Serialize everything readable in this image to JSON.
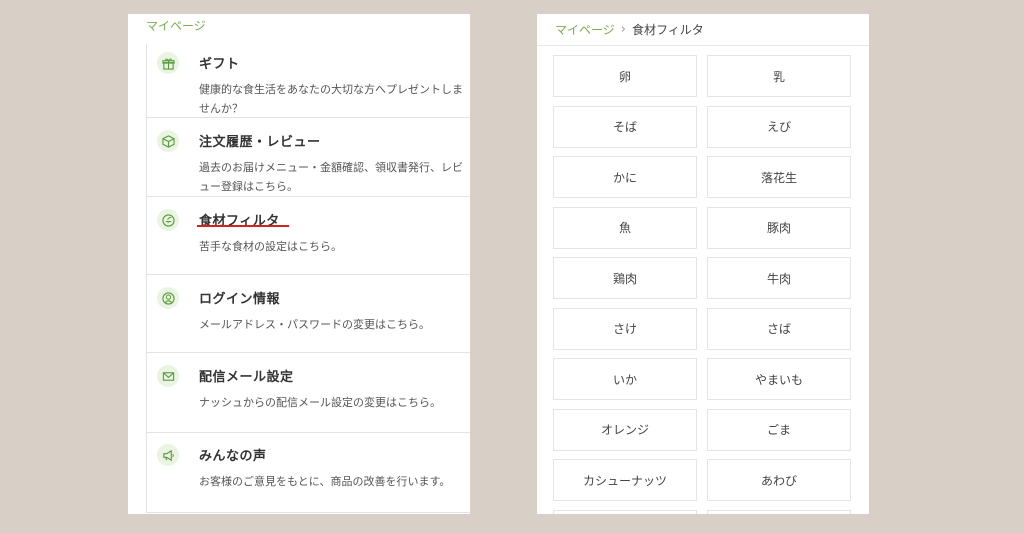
{
  "left": {
    "breadcrumb": "マイページ",
    "menu": [
      {
        "title": "ギフト",
        "desc": "健康的な食生活をあなたの大切な方へプレゼントしませんか？",
        "icon": "gift-icon"
      },
      {
        "title": "注文履歴・レビュー",
        "desc": "過去のお届けメニュー・金額確認、領収書発行、レビュー登録はこちら。",
        "icon": "box-icon"
      },
      {
        "title": "食材フィルタ",
        "desc": "苦手な食材の設定はこちら。",
        "icon": "food-bowl-icon"
      },
      {
        "title": "ログイン情報",
        "desc": "メールアドレス・パスワードの変更はこちら。",
        "icon": "user-icon"
      },
      {
        "title": "配信メール設定",
        "desc": "ナッシュからの配信メール設定の変更はこちら。",
        "icon": "mail-icon"
      },
      {
        "title": "みんなの声",
        "desc": "お客様のご意見をもとに、商品の改善を行います。",
        "icon": "megaphone-icon"
      }
    ]
  },
  "right": {
    "breadcrumb_link": "マイページ",
    "breadcrumb_sep": "›",
    "breadcrumb_current": "食材フィルタ",
    "items": [
      "卵",
      "乳",
      "そば",
      "えび",
      "かに",
      "落花生",
      "魚",
      "豚肉",
      "鶏肉",
      "牛肉",
      "さけ",
      "さば",
      "いか",
      "やまいも",
      "オレンジ",
      "ごま",
      "カシューナッツ",
      "あわび"
    ]
  },
  "colors": {
    "background": "#d8cfc6",
    "accent_green": "#7aae4e",
    "underline_red": "#d32222"
  }
}
